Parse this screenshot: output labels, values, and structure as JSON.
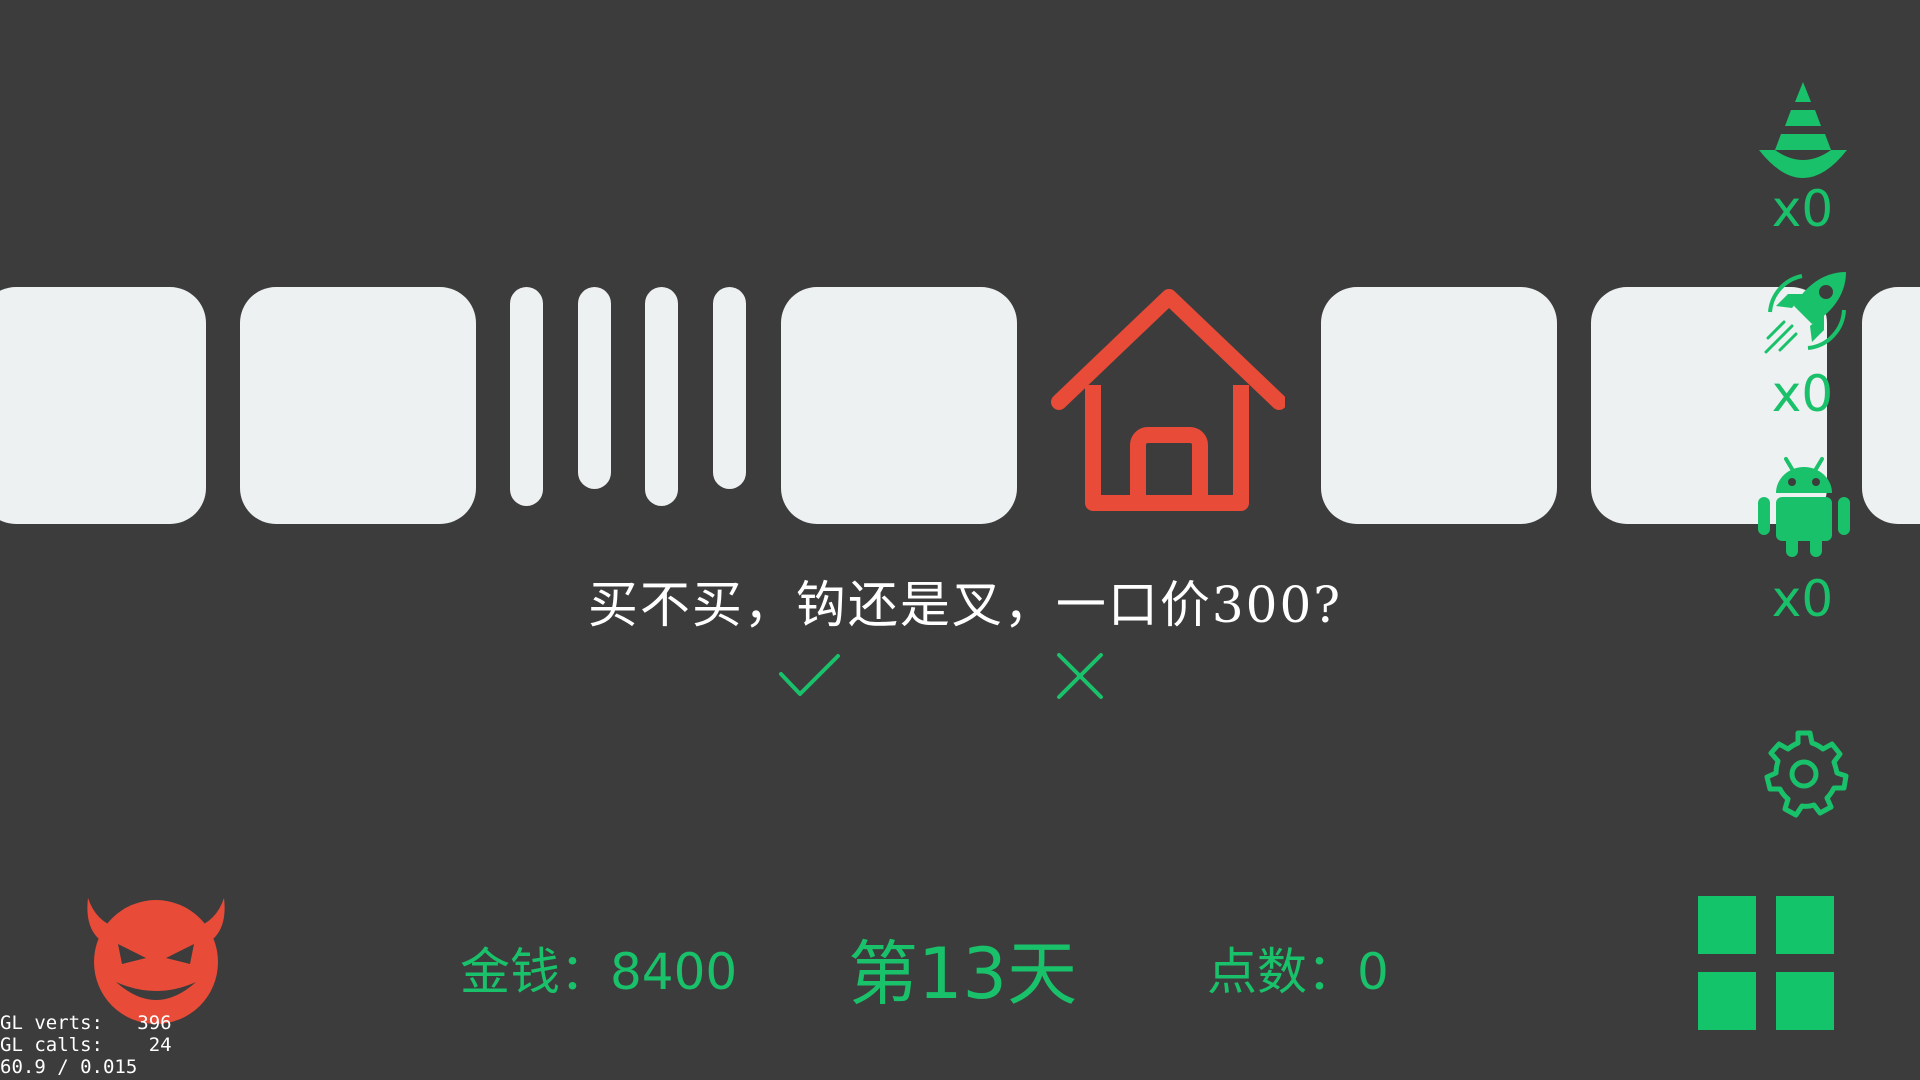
{
  "colors": {
    "background": "#3c3c3c",
    "tile": "#eef1f2",
    "accent_green": "#19c16a",
    "accent_red": "#e84b37"
  },
  "question": {
    "text": "买不买，钩还是叉，一口价300?"
  },
  "choices": {
    "confirm_icon": "check-icon",
    "cancel_icon": "x-icon"
  },
  "inventory": [
    {
      "icon": "traffic-cone-icon",
      "count": "x0"
    },
    {
      "icon": "rocket-icon",
      "count": "x0"
    },
    {
      "icon": "android-robot-icon",
      "count": "x0"
    }
  ],
  "stats": {
    "money": "金钱：8400",
    "day": "第13天",
    "points": "点数：0"
  },
  "debug": {
    "line1": "GL verts:   396",
    "line2": "GL calls:    24",
    "line3": "60.9 / 0.015"
  },
  "icons": {
    "center": "house-icon",
    "settings": "gear-icon",
    "menu": "grid-menu-icon",
    "player": "devil-face-icon"
  }
}
